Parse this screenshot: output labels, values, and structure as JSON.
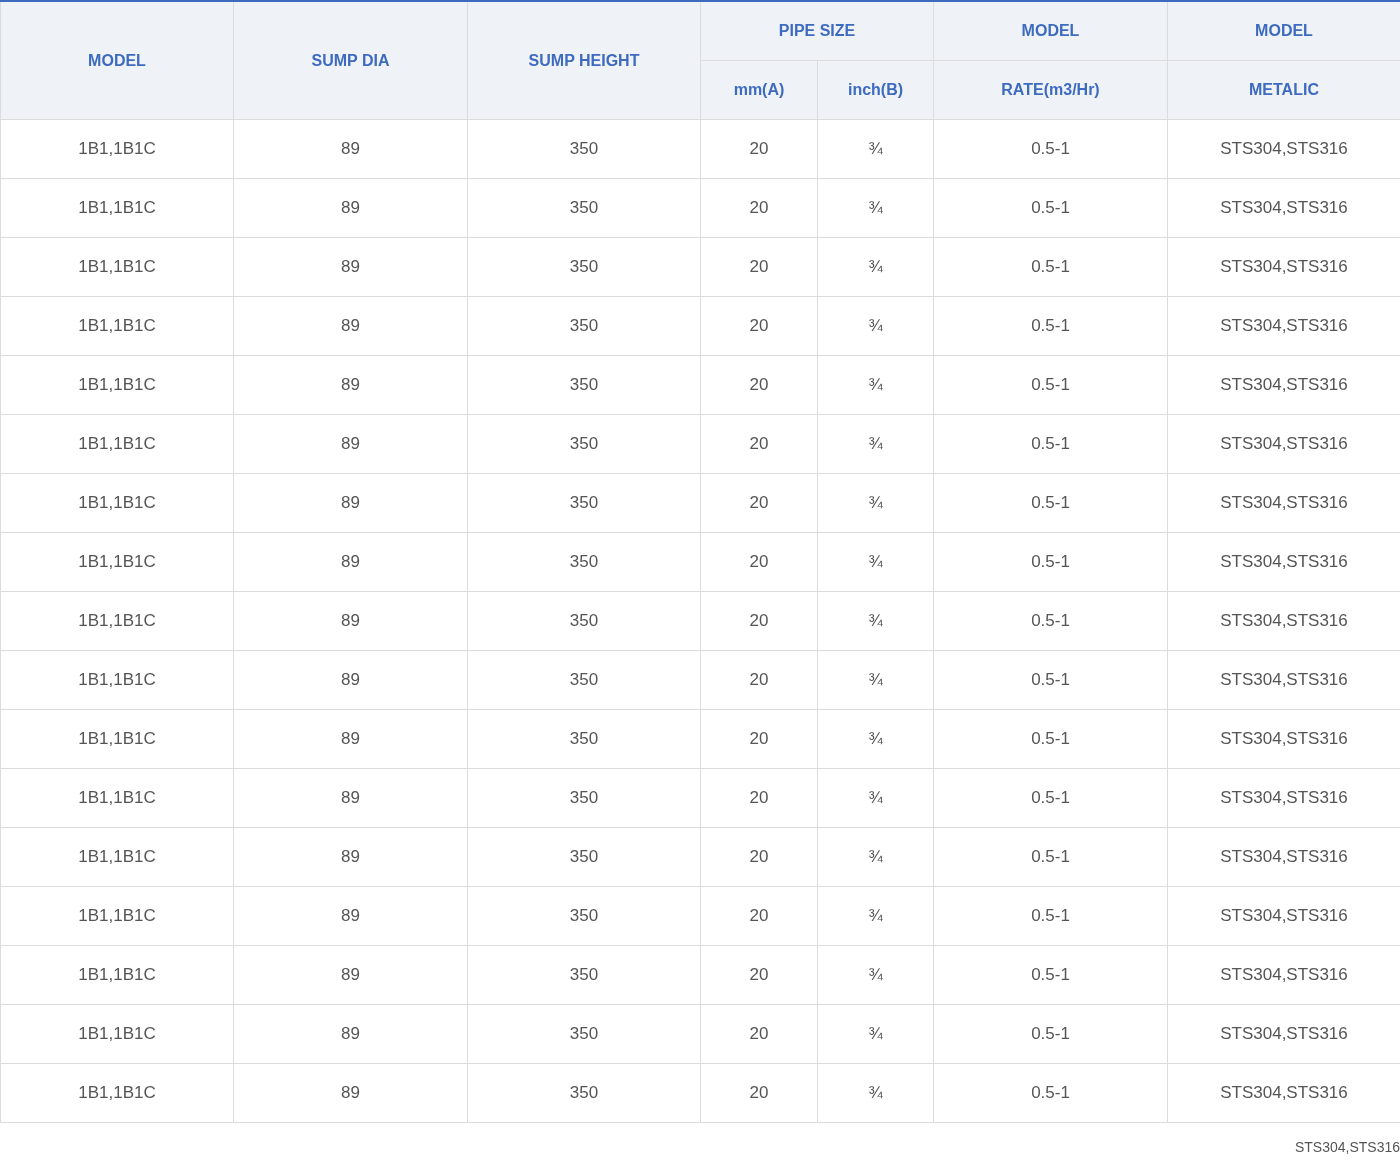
{
  "table": {
    "header_rows": [
      [
        {
          "label": "MODEL",
          "rowspan": 2
        },
        {
          "label": "SUMP DIA",
          "rowspan": 2
        },
        {
          "label": "SUMP HEIGHT",
          "rowspan": 2
        },
        {
          "label": "PIPE SIZE",
          "colspan": 2
        },
        {
          "label": "MODEL"
        },
        {
          "label": "MODEL"
        }
      ],
      [
        {
          "label": "mm(A)"
        },
        {
          "label": "inch(B)"
        },
        {
          "label": "RATE(m3/Hr)"
        },
        {
          "label": "METALIC"
        }
      ]
    ],
    "rows": [
      [
        "1B1,1B1C",
        "89",
        "350",
        "20",
        "¾",
        "0.5-1",
        "STS304,STS316"
      ],
      [
        "1B1,1B1C",
        "89",
        "350",
        "20",
        "¾",
        "0.5-1",
        "STS304,STS316"
      ],
      [
        "1B1,1B1C",
        "89",
        "350",
        "20",
        "¾",
        "0.5-1",
        "STS304,STS316"
      ],
      [
        "1B1,1B1C",
        "89",
        "350",
        "20",
        "¾",
        "0.5-1",
        "STS304,STS316"
      ],
      [
        "1B1,1B1C",
        "89",
        "350",
        "20",
        "¾",
        "0.5-1",
        "STS304,STS316"
      ],
      [
        "1B1,1B1C",
        "89",
        "350",
        "20",
        "¾",
        "0.5-1",
        "STS304,STS316"
      ],
      [
        "1B1,1B1C",
        "89",
        "350",
        "20",
        "¾",
        "0.5-1",
        "STS304,STS316"
      ],
      [
        "1B1,1B1C",
        "89",
        "350",
        "20",
        "¾",
        "0.5-1",
        "STS304,STS316"
      ],
      [
        "1B1,1B1C",
        "89",
        "350",
        "20",
        "¾",
        "0.5-1",
        "STS304,STS316"
      ],
      [
        "1B1,1B1C",
        "89",
        "350",
        "20",
        "¾",
        "0.5-1",
        "STS304,STS316"
      ],
      [
        "1B1,1B1C",
        "89",
        "350",
        "20",
        "¾",
        "0.5-1",
        "STS304,STS316"
      ],
      [
        "1B1,1B1C",
        "89",
        "350",
        "20",
        "¾",
        "0.5-1",
        "STS304,STS316"
      ],
      [
        "1B1,1B1C",
        "89",
        "350",
        "20",
        "¾",
        "0.5-1",
        "STS304,STS316"
      ],
      [
        "1B1,1B1C",
        "89",
        "350",
        "20",
        "¾",
        "0.5-1",
        "STS304,STS316"
      ],
      [
        "1B1,1B1C",
        "89",
        "350",
        "20",
        "¾",
        "0.5-1",
        "STS304,STS316"
      ],
      [
        "1B1,1B1C",
        "89",
        "350",
        "20",
        "¾",
        "0.5-1",
        "STS304,STS316"
      ],
      [
        "1B1,1B1C",
        "89",
        "350",
        "20",
        "¾",
        "0.5-1",
        "STS304,STS316"
      ]
    ]
  },
  "footnote": "STS304,STS316"
}
